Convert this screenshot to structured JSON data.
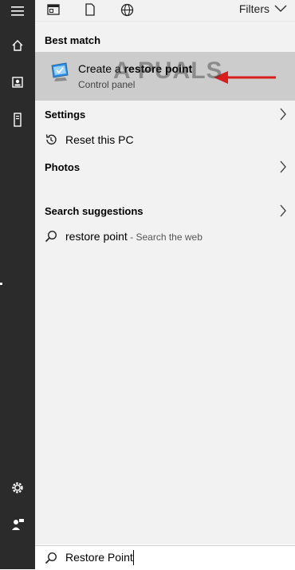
{
  "filters": {
    "label": "Filters"
  },
  "watermark": {
    "text": "A  PUALS"
  },
  "best_match": {
    "header": "Best match",
    "title_prefix": "Create a ",
    "title_bold": "restore point",
    "subtitle": "Control panel"
  },
  "settings": {
    "header": "Settings",
    "item": "Reset this PC"
  },
  "photos": {
    "header": "Photos"
  },
  "suggestions": {
    "header": "Search suggestions",
    "term": "restore point",
    "hint": " - Search the web"
  },
  "search": {
    "query": "Restore Point"
  },
  "colors": {
    "rail": "#2b2b2b",
    "panel": "#f2f2f2",
    "highlight": "#cccccc",
    "arrow": "#d91e1e"
  },
  "icons": {
    "rail": [
      "hamburger-icon",
      "home-icon",
      "documents-icon",
      "tower-icon",
      "settings-gear-icon",
      "user-feedback-icon"
    ],
    "top": [
      "apps-icon",
      "document-icon",
      "web-globe-icon",
      "chevron-down-icon"
    ]
  }
}
